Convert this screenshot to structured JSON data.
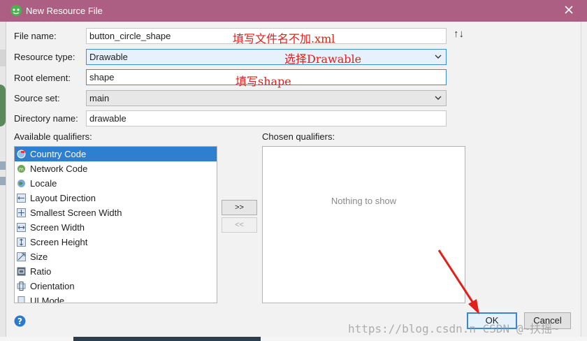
{
  "window": {
    "title": "New Resource File",
    "accent_color": "#ac5f82"
  },
  "form": {
    "file_name": {
      "label": "File name:",
      "value": "button_circle_shape"
    },
    "resource_type": {
      "label": "Resource type:",
      "value": "Drawable"
    },
    "root_element": {
      "label": "Root element:",
      "value": "shape"
    },
    "source_set": {
      "label": "Source set:",
      "value": "main"
    },
    "directory_name": {
      "label": "Directory name:",
      "value": "drawable"
    }
  },
  "annotations": {
    "file_name_note": "填写文件名不加.xml",
    "resource_type_note": "选择Drawable",
    "root_element_note": "填写shape",
    "color": "#e0201a"
  },
  "qualifiers": {
    "available_label": "Available qualifiers:",
    "chosen_label": "Chosen qualifiers:",
    "items": [
      {
        "label": "Country Code",
        "icon": "globe-flag-icon",
        "selected": true
      },
      {
        "label": "Network Code",
        "icon": "network-code-icon"
      },
      {
        "label": "Locale",
        "icon": "globe-icon"
      },
      {
        "label": "Layout Direction",
        "icon": "layout-direction-icon"
      },
      {
        "label": "Smallest Screen Width",
        "icon": "smallest-width-icon"
      },
      {
        "label": "Screen Width",
        "icon": "screen-width-icon"
      },
      {
        "label": "Screen Height",
        "icon": "screen-height-icon"
      },
      {
        "label": "Size",
        "icon": "size-icon"
      },
      {
        "label": "Ratio",
        "icon": "ratio-icon"
      },
      {
        "label": "Orientation",
        "icon": "orientation-icon"
      },
      {
        "label": "UI Mode",
        "icon": "ui-mode-icon"
      }
    ],
    "empty_text": "Nothing to show",
    "add_label": ">>",
    "remove_label": "<<"
  },
  "buttons": {
    "ok": "OK",
    "cancel": "Cancel",
    "sort_glyph": "↑↓"
  },
  "watermark": "https://blog.csdn.n CSDN @~扶摇~"
}
